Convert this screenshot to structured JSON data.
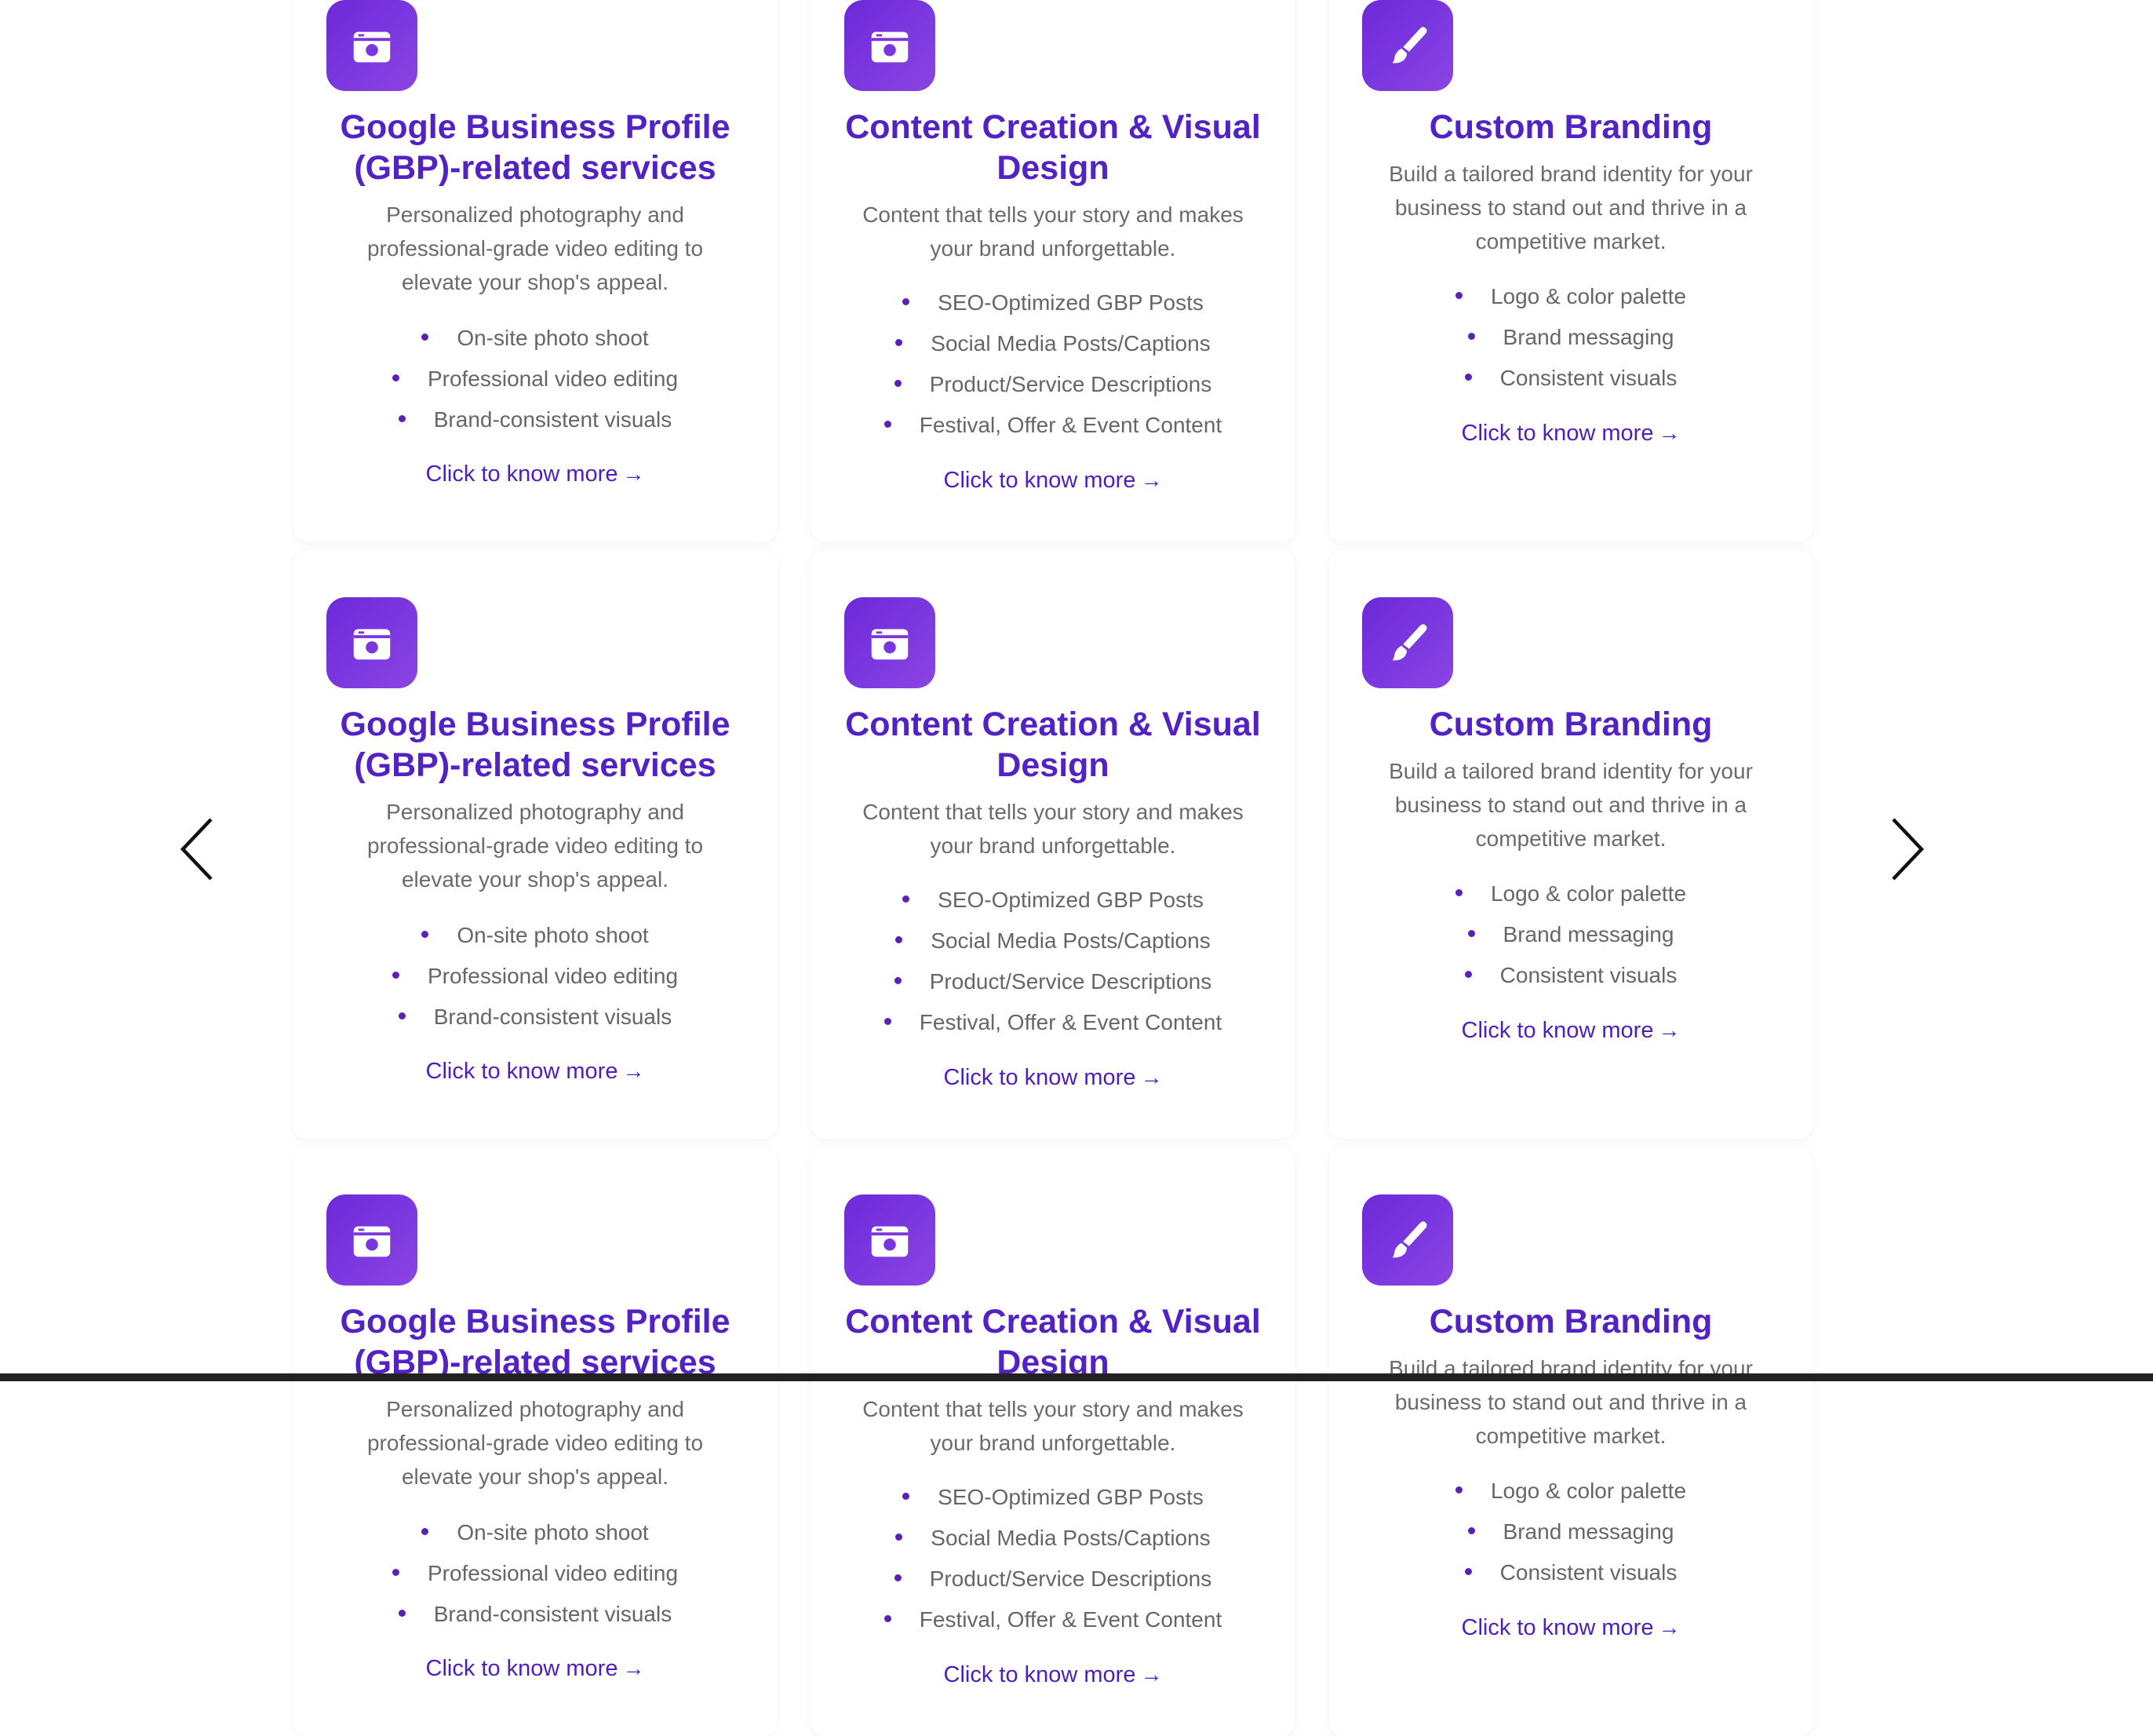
{
  "cards": [
    {
      "icon": "camera-icon",
      "title": "Google Business Profile (GBP)-related services",
      "description": "Personalized photography and professional-grade video editing to elevate your shop's appeal.",
      "features": [
        "On-site photo shoot",
        "Professional video editing",
        "Brand-consistent visuals"
      ],
      "cta": "Click to know more"
    },
    {
      "icon": "camera-icon",
      "title": "Content Creation & Visual Design",
      "description": "Content that tells your story and makes your brand unforgettable.",
      "features": [
        "SEO-Optimized GBP Posts",
        "Social Media Posts/Captions",
        "Product/Service Descriptions",
        "Festival, Offer & Event Content"
      ],
      "cta": "Click to know more"
    },
    {
      "icon": "paintbrush-icon",
      "title": "Custom Branding",
      "description": "Build a tailored brand identity for your business to stand out and thrive in a competitive market.",
      "features": [
        "Logo & color palette",
        "Brand messaging",
        "Consistent visuals"
      ],
      "cta": "Click to know more"
    }
  ],
  "cta_arrow": "→",
  "navigation": {
    "prev_icon": "chevron-left-icon",
    "next_icon": "chevron-right-icon"
  },
  "colors": {
    "title": "#5222c4",
    "bullet": "#5b21b6",
    "icon_gradient_start": "#6d28d9",
    "icon_gradient_end": "#8b44e2",
    "text": "#6b6b6b"
  }
}
